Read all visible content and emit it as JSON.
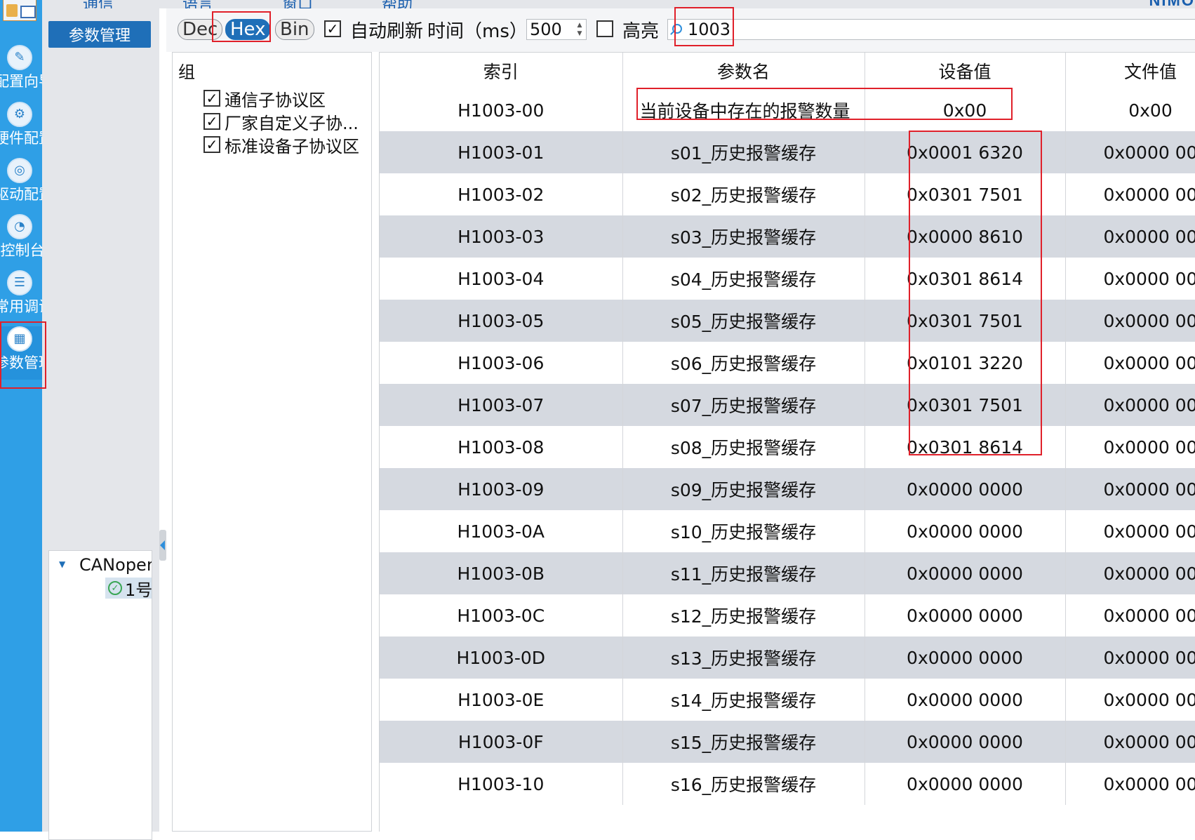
{
  "menu": {
    "items": [
      "通信",
      "语言",
      "窗口",
      "帮助"
    ],
    "brand": "NIMO"
  },
  "nav": {
    "items": [
      {
        "label": "配置向导",
        "icon": "wizard-icon"
      },
      {
        "label": "硬件配置",
        "icon": "hardware-config-icon"
      },
      {
        "label": "驱动配置",
        "icon": "drive-config-icon"
      },
      {
        "label": "控制台",
        "icon": "console-gauge-icon"
      },
      {
        "label": "常用调试",
        "icon": "sliders-icon"
      },
      {
        "label": "参数管理",
        "icon": "param-grid-icon"
      }
    ],
    "active": "参数管理"
  },
  "tree": {
    "tab_label": "参数管理",
    "root": "CANopen",
    "child": "1号"
  },
  "toolbar": {
    "dec": "Dec",
    "hex": "Hex",
    "bin": "Bin",
    "auto_refresh_label": "自动刷新",
    "auto_refresh_checked": true,
    "interval_label": "时间（ms）",
    "interval_value": "500",
    "highlight_label": "高亮",
    "highlight_checked": false,
    "search_value": "1003"
  },
  "groups": {
    "title": "组",
    "items": [
      {
        "label": "通信子协议区",
        "checked": true
      },
      {
        "label": "厂家自定义子协...",
        "checked": true
      },
      {
        "label": "标准设备子协议区",
        "checked": true
      }
    ]
  },
  "table": {
    "columns": [
      "索引",
      "参数名",
      "设备值",
      "文件值"
    ],
    "rows": [
      [
        "H1003-00",
        "当前设备中存在的报警数量",
        "0x00",
        "0x00"
      ],
      [
        "H1003-01",
        "s01_历史报警缓存",
        "0x0001 6320",
        "0x0000 00"
      ],
      [
        "H1003-02",
        "s02_历史报警缓存",
        "0x0301 7501",
        "0x0000 00"
      ],
      [
        "H1003-03",
        "s03_历史报警缓存",
        "0x0000 8610",
        "0x0000 00"
      ],
      [
        "H1003-04",
        "s04_历史报警缓存",
        "0x0301 8614",
        "0x0000 00"
      ],
      [
        "H1003-05",
        "s05_历史报警缓存",
        "0x0301 7501",
        "0x0000 00"
      ],
      [
        "H1003-06",
        "s06_历史报警缓存",
        "0x0101 3220",
        "0x0000 00"
      ],
      [
        "H1003-07",
        "s07_历史报警缓存",
        "0x0301 7501",
        "0x0000 00"
      ],
      [
        "H1003-08",
        "s08_历史报警缓存",
        "0x0301 8614",
        "0x0000 00"
      ],
      [
        "H1003-09",
        "s09_历史报警缓存",
        "0x0000 0000",
        "0x0000 00"
      ],
      [
        "H1003-0A",
        "s10_历史报警缓存",
        "0x0000 0000",
        "0x0000 00"
      ],
      [
        "H1003-0B",
        "s11_历史报警缓存",
        "0x0000 0000",
        "0x0000 00"
      ],
      [
        "H1003-0C",
        "s12_历史报警缓存",
        "0x0000 0000",
        "0x0000 00"
      ],
      [
        "H1003-0D",
        "s13_历史报警缓存",
        "0x0000 0000",
        "0x0000 00"
      ],
      [
        "H1003-0E",
        "s14_历史报警缓存",
        "0x0000 0000",
        "0x0000 00"
      ],
      [
        "H1003-0F",
        "s15_历史报警缓存",
        "0x0000 0000",
        "0x0000 00"
      ],
      [
        "H1003-10",
        "s16_历史报警缓存",
        "0x0000 0000",
        "0x0000 00"
      ]
    ]
  },
  "colors": {
    "nav_bg": "#2f9fe6",
    "accent": "#1f6fb8",
    "row_alt": "#d5d9e0",
    "annotation_red": "#e0202a"
  }
}
